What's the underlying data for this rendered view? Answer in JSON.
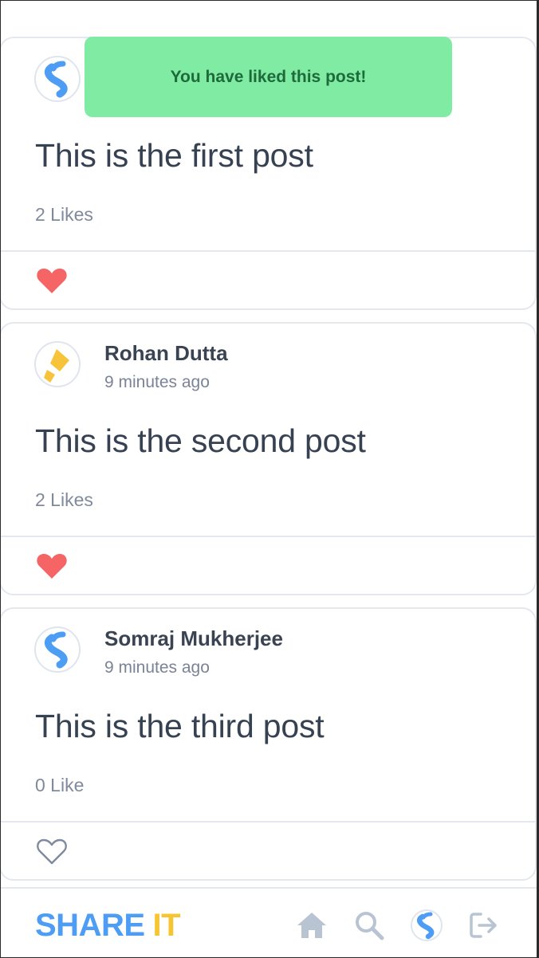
{
  "toast": {
    "message": "You have liked this post!"
  },
  "posts": [
    {
      "author": "",
      "time": "",
      "text": "This is the first post",
      "likes": "2 Likes",
      "liked": true,
      "avatar": "s-logo-blue"
    },
    {
      "author": "Rohan Dutta",
      "time": "9 minutes ago",
      "text": "This is the second post",
      "likes": "2 Likes",
      "liked": true,
      "avatar": "p-logo-yellow"
    },
    {
      "author": "Somraj Mukherjee",
      "time": "9 minutes ago",
      "text": "This is the third post",
      "likes": "0 Like",
      "liked": false,
      "avatar": "s-logo-blue"
    }
  ],
  "bottom_nav": {
    "brand_part1": "SHARE",
    "brand_part2": "IT",
    "icons": [
      "home-icon",
      "search-icon",
      "profile-avatar-icon",
      "logout-icon"
    ]
  },
  "colors": {
    "brand_blue": "#4e9df5",
    "brand_yellow": "#f7c531",
    "heart_red": "#f56565",
    "toast_bg": "#80eba3",
    "toast_text": "#1d6a3a"
  }
}
